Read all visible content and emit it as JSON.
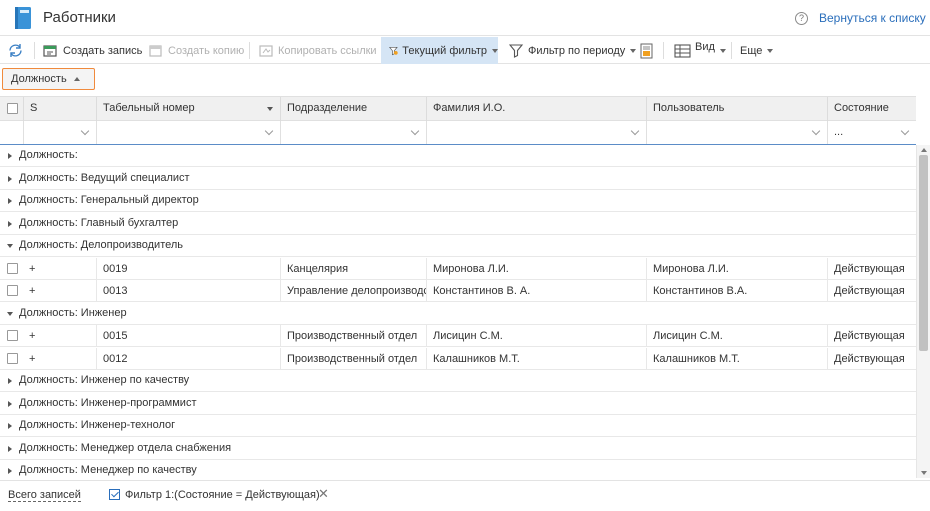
{
  "header": {
    "title": "Работники",
    "help_glyph": "?",
    "back_link": "Вернуться к списку"
  },
  "toolbar": {
    "create": "Создать запись",
    "copy": "Создать копию",
    "copy_links": "Копировать ссылки",
    "current_filter": "Текущий фильтр",
    "period_filter": "Фильтр по периоду",
    "view": "Вид",
    "more": "Еще"
  },
  "group_chip": {
    "label": "Должность"
  },
  "columns": {
    "s": "S",
    "tab_number": "Табельный номер",
    "department": "Подразделение",
    "name": "Фамилия И.О.",
    "user": "Пользователь",
    "status": "Состояние"
  },
  "filters": {
    "status_value": "..."
  },
  "groups": [
    {
      "label": "Должность:",
      "expanded": false,
      "rows": []
    },
    {
      "label": "Должность: Ведущий специалист",
      "expanded": false,
      "rows": []
    },
    {
      "label": "Должность: Генеральный директор",
      "expanded": false,
      "rows": []
    },
    {
      "label": "Должность: Главный бухгалтер",
      "expanded": false,
      "rows": []
    },
    {
      "label": "Должность: Делопроизводитель",
      "expanded": true,
      "rows": [
        {
          "s": "+",
          "tab": "0019",
          "dept": "Канцелярия",
          "name": "Миронова Л.И.",
          "user": "Миронова Л.И.",
          "status": "Действующая"
        },
        {
          "s": "+",
          "tab": "0013",
          "dept": "Управление делопроизводства",
          "name": "Константинов В. А.",
          "user": "Константинов В.А.",
          "status": "Действующая"
        }
      ]
    },
    {
      "label": "Должность: Инженер",
      "expanded": true,
      "rows": [
        {
          "s": "+",
          "tab": "0015",
          "dept": "Производственный отдел",
          "name": "Лисицин С.М.",
          "user": "Лисицин С.М.",
          "status": "Действующая"
        },
        {
          "s": "+",
          "tab": "0012",
          "dept": "Производственный отдел",
          "name": "Калашников М.Т.",
          "user": "Калашников М.Т.",
          "status": "Действующая"
        }
      ]
    },
    {
      "label": "Должность: Инженер по качеству",
      "expanded": false,
      "rows": []
    },
    {
      "label": "Должность: Инженер-программист",
      "expanded": false,
      "rows": []
    },
    {
      "label": "Должность: Инженер-технолог",
      "expanded": false,
      "rows": []
    },
    {
      "label": "Должность: Менеджер отдела снабжения",
      "expanded": false,
      "rows": []
    },
    {
      "label": "Должность: Менеджер по качеству",
      "expanded": false,
      "rows": []
    }
  ],
  "footer": {
    "total": "Всего записей",
    "filter": "Фильтр 1:(Состояние = Действующая)",
    "filter_close_glyph": "✕"
  },
  "colors": {
    "accent": "#2a6ebb",
    "chip_border": "#f08a3c",
    "active_tool": "#d5e5f5"
  }
}
